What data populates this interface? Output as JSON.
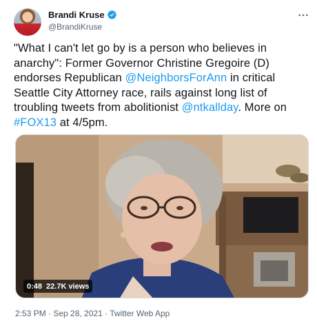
{
  "author": {
    "display_name": "Brandi Kruse",
    "handle": "@BrandiKruse"
  },
  "tweet": {
    "segments": [
      {
        "text": "\"What I can't let go by is a person who believes in anarchy\": Former Governor Christine Gregoire (D) endorses Republican ",
        "link": false
      },
      {
        "text": "@NeighborsForAnn",
        "link": true
      },
      {
        "text": " in critical Seattle City Attorney race, rails against long list of troubling tweets from abolitionist ",
        "link": false
      },
      {
        "text": "@ntkallday",
        "link": true
      },
      {
        "text": ". More on ",
        "link": false
      },
      {
        "text": "#FOX13",
        "link": true
      },
      {
        "text": " at 4/5pm.",
        "link": false
      }
    ]
  },
  "video": {
    "duration": "0:48",
    "views": "22.7K views"
  },
  "meta": {
    "timestamp": "2:53 PM · Sep 28, 2021 · Twitter Web App"
  },
  "icons": {
    "verified": "verified-badge-icon",
    "more": "more-options-icon"
  },
  "colors": {
    "link": "#1d9bf0",
    "secondary_text": "#536471",
    "border": "#cfd9de"
  }
}
